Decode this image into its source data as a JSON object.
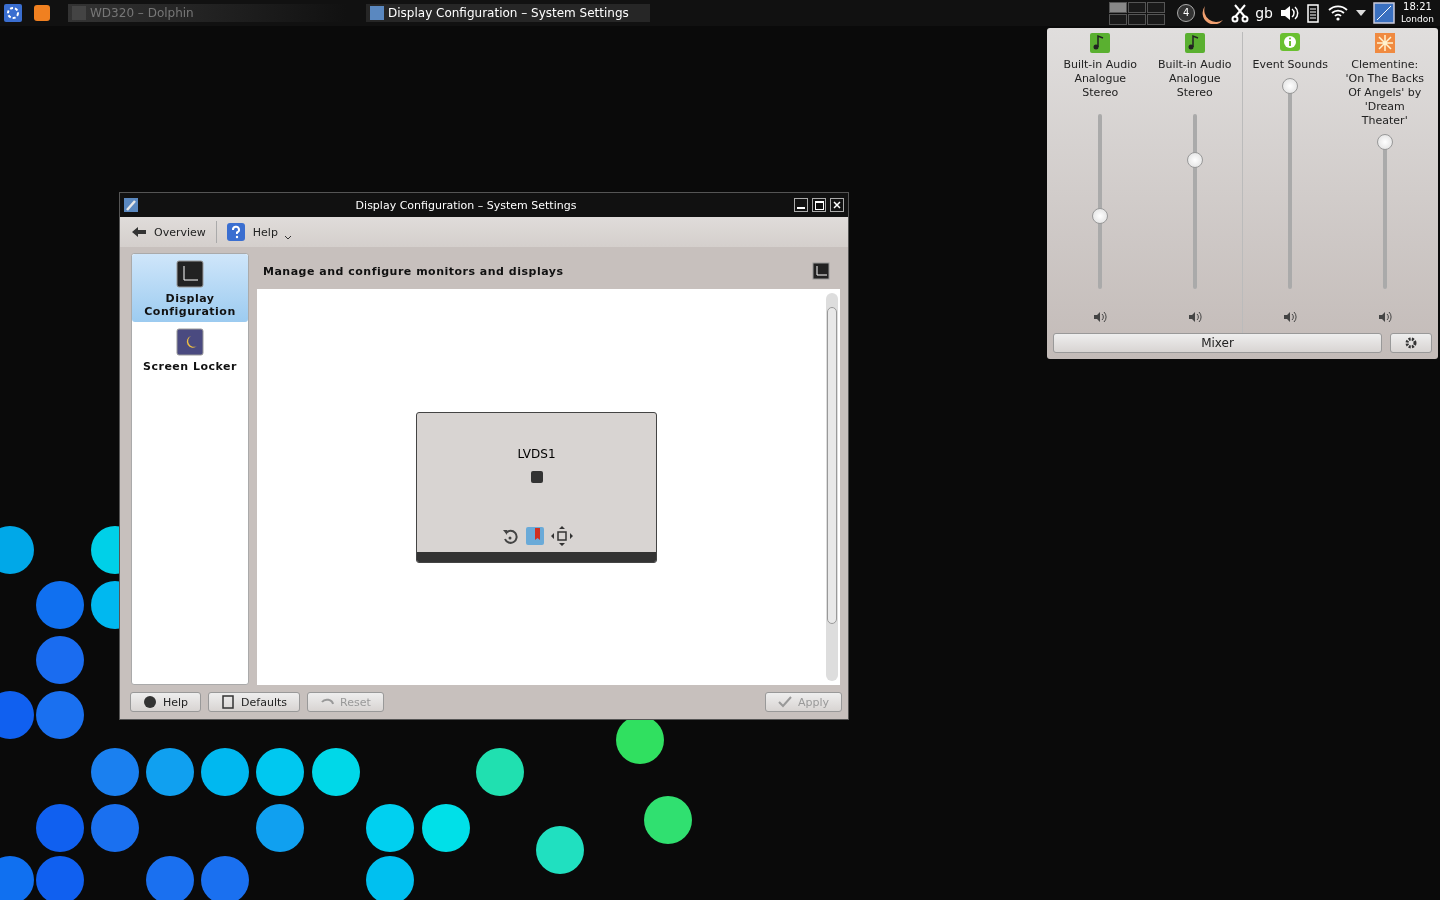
{
  "taskbar": {
    "tasks": [
      {
        "title": "WD320 – Dolphin",
        "selected": false
      },
      {
        "title": "Display Configuration – System Settings",
        "selected": true
      }
    ],
    "pager": [
      {
        "selected": true
      },
      {
        "selected": false
      },
      {
        "selected": false
      },
      {
        "selected": false
      },
      {
        "selected": false
      },
      {
        "selected": false
      }
    ],
    "notification_count": "4",
    "keyboard_layout": "gb",
    "clock": {
      "time": "18:21",
      "zone": "London"
    }
  },
  "window": {
    "title": "Display Configuration – System Settings",
    "toolbar": {
      "back": "Overview",
      "help": "Help"
    },
    "sidebar": {
      "items": [
        {
          "label": "Display Configuration",
          "selected": true
        },
        {
          "label": "Screen Locker",
          "selected": false
        }
      ]
    },
    "heading": "Manage and configure monitors and displays",
    "output": {
      "name": "LVDS1"
    },
    "buttons": [
      {
        "label": "Help",
        "disabled": false
      },
      {
        "label": "Defaults",
        "disabled": false
      },
      {
        "label": "Reset",
        "disabled": true
      },
      {
        "label": "Apply",
        "disabled": true
      }
    ]
  },
  "volume_popup": {
    "channels": [
      {
        "name": "Built-in Audio Analogue Stereo",
        "kind": "device",
        "level": 0.42
      },
      {
        "name": "Built-in Audio Analogue Stereo",
        "kind": "device",
        "level": 0.74
      },
      {
        "name": "Event Sounds",
        "kind": "info",
        "level": 1
      },
      {
        "name": "Clementine: 'On The Backs Of Angels' by 'Dream Theater'",
        "kind": "app",
        "level": 1
      }
    ],
    "mixer_button": "Mixer"
  }
}
